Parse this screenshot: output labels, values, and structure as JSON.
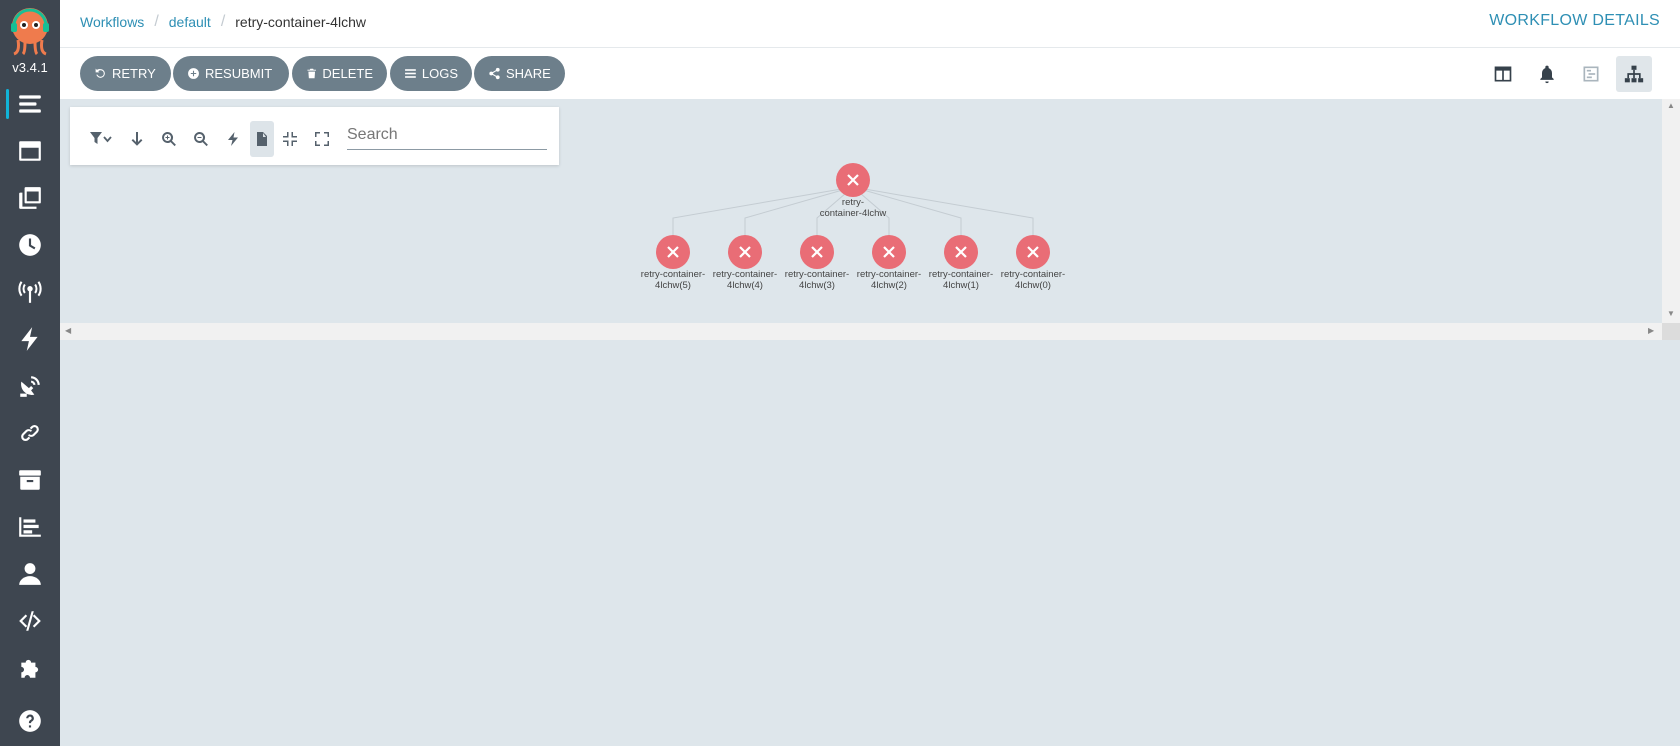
{
  "app": {
    "version": "v3.4.1",
    "logo_icon": "argo-octopus-logo"
  },
  "sidebar": {
    "items": [
      {
        "name": "workflows",
        "icon": "stream-icon",
        "active": true
      },
      {
        "name": "workflow-templates",
        "icon": "window-icon"
      },
      {
        "name": "cluster-workflow-templates",
        "icon": "clone-icon"
      },
      {
        "name": "cron-workflows",
        "icon": "clock-icon"
      },
      {
        "name": "event-sources",
        "icon": "broadcast-tower-icon"
      },
      {
        "name": "sensors",
        "icon": "bolt-icon"
      },
      {
        "name": "event-flow",
        "icon": "satellite-dish-icon"
      },
      {
        "name": "api-docs-link",
        "icon": "link-icon"
      },
      {
        "name": "archived-workflows",
        "icon": "archive-icon"
      },
      {
        "name": "reports",
        "icon": "chart-bar-icon"
      },
      {
        "name": "user",
        "icon": "user-icon"
      },
      {
        "name": "api-docs",
        "icon": "code-icon"
      },
      {
        "name": "plugins",
        "icon": "puzzle-piece-icon"
      },
      {
        "name": "help",
        "icon": "question-circle-icon"
      }
    ]
  },
  "breadcrumb": {
    "items": [
      "Workflows",
      "default"
    ],
    "current": "retry-container-4lchw"
  },
  "header": {
    "title": "WORKFLOW DETAILS"
  },
  "actions": {
    "retry": "RETRY",
    "resubmit": "RESUBMIT",
    "delete": "DELETE",
    "logs": "LOGS",
    "share": "SHARE"
  },
  "view_buttons": [
    {
      "name": "split-view",
      "icon": "columns-icon"
    },
    {
      "name": "events",
      "icon": "bell-icon"
    },
    {
      "name": "timeline",
      "icon": "timeline-icon"
    },
    {
      "name": "graph-view",
      "icon": "sitemap-icon",
      "active": true
    }
  ],
  "graph_toolbar": {
    "tools": [
      "filter-icon",
      "arrow-down-icon",
      "zoom-in-icon",
      "zoom-out-icon",
      "bolt-icon",
      "file-icon",
      "compress-icon",
      "expand-icon"
    ],
    "search_placeholder": "Search"
  },
  "graph": {
    "root": {
      "label_line1": "retry-",
      "label_line2": "container-4lchw",
      "status": "failed"
    },
    "children": [
      {
        "label_line1": "retry-container-",
        "label_line2": "4lchw(5)",
        "status": "failed"
      },
      {
        "label_line1": "retry-container-",
        "label_line2": "4lchw(4)",
        "status": "failed"
      },
      {
        "label_line1": "retry-container-",
        "label_line2": "4lchw(3)",
        "status": "failed"
      },
      {
        "label_line1": "retry-container-",
        "label_line2": "4lchw(2)",
        "status": "failed"
      },
      {
        "label_line1": "retry-container-",
        "label_line2": "4lchw(1)",
        "status": "failed"
      },
      {
        "label_line1": "retry-container-",
        "label_line2": "4lchw(0)",
        "status": "failed"
      }
    ],
    "failed_color": "#e96d76"
  },
  "colors": {
    "sidebar": "#3e4650",
    "accent": "#2e8fb4",
    "button": "#6d7f8b",
    "background": "#dee6eb"
  }
}
